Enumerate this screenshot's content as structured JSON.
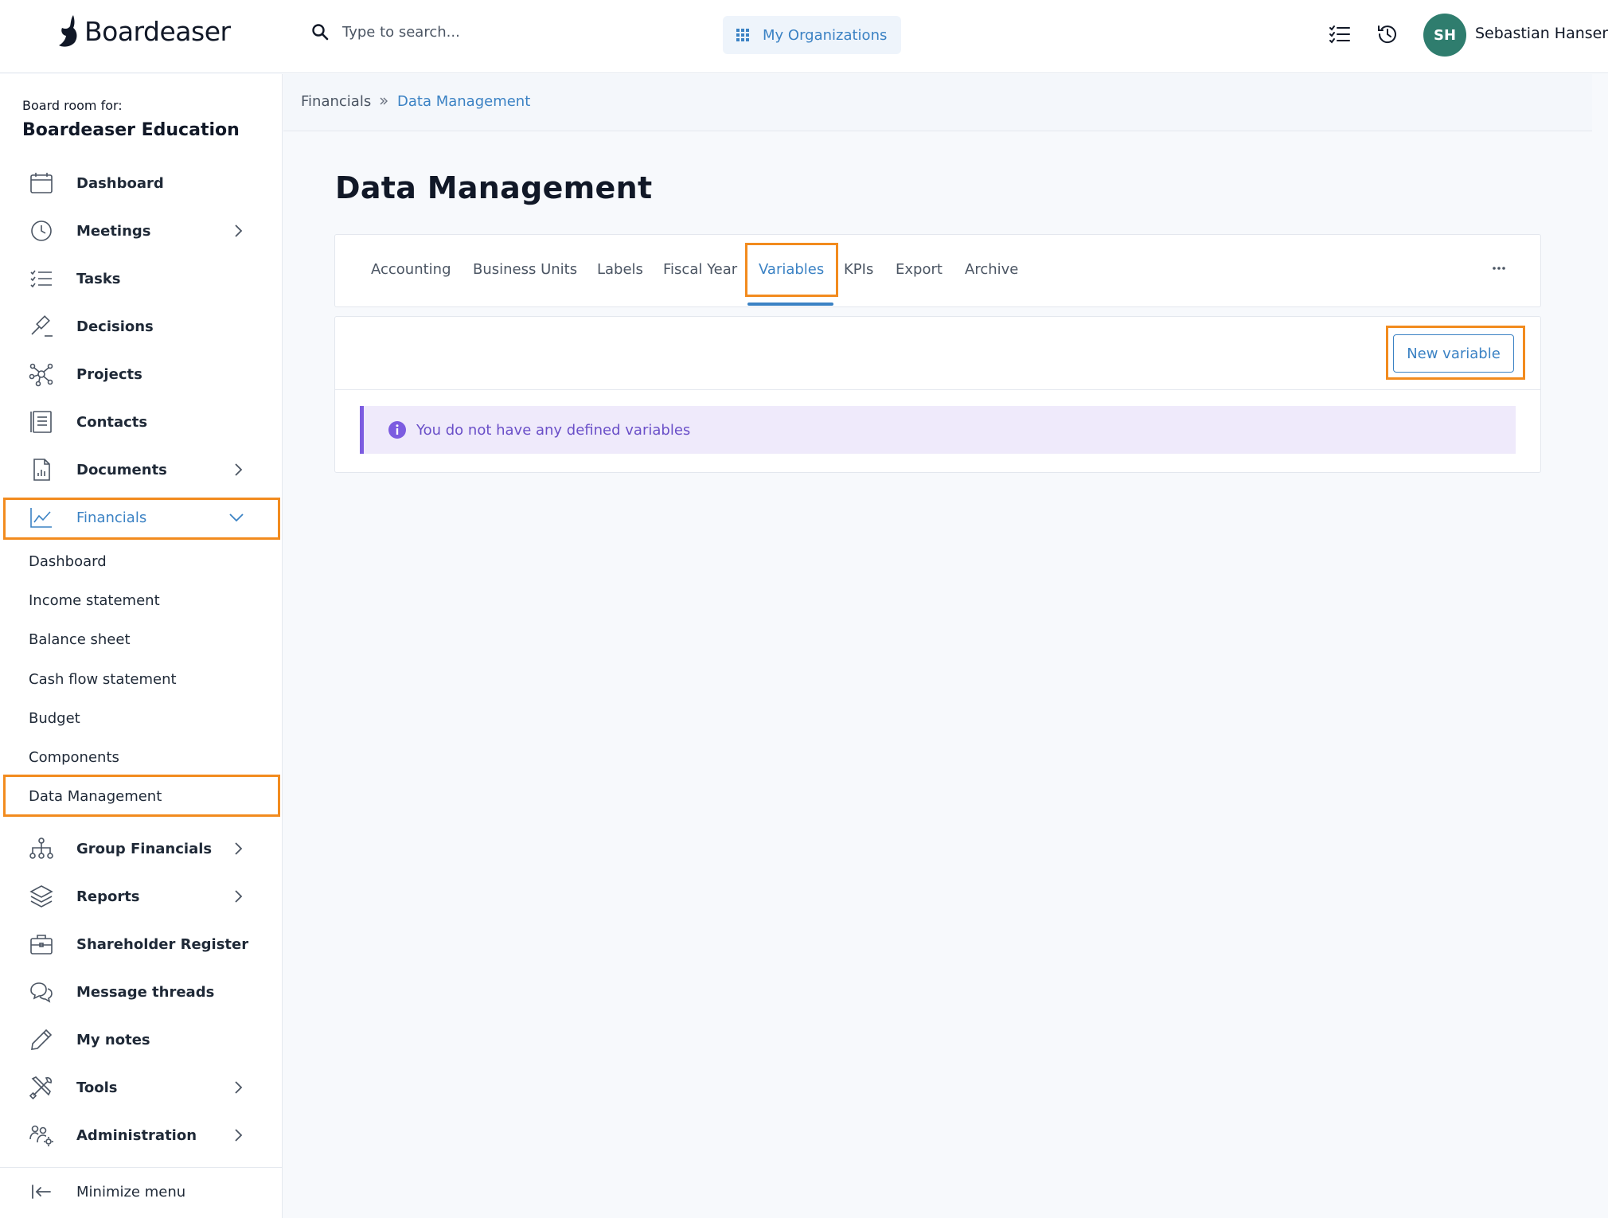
{
  "brand": {
    "name": "Boardeaser"
  },
  "search": {
    "placeholder": "Type to search..."
  },
  "header": {
    "orgs_label": "My Organizations",
    "user_initials": "SH",
    "user_name": "Sebastian Hansen"
  },
  "sidebar": {
    "board_for_label": "Board room for:",
    "board_name": "Boardeaser Education",
    "items": [
      {
        "label": "Dashboard",
        "icon": "calendar-icon"
      },
      {
        "label": "Meetings",
        "icon": "clock-icon"
      },
      {
        "label": "Tasks",
        "icon": "checklist-icon"
      },
      {
        "label": "Decisions",
        "icon": "gavel-icon"
      },
      {
        "label": "Projects",
        "icon": "network-icon"
      },
      {
        "label": "Contacts",
        "icon": "address-book-icon"
      },
      {
        "label": "Documents",
        "icon": "document-icon"
      },
      {
        "label": "Financials",
        "icon": "line-chart-icon"
      }
    ],
    "financials_sub": [
      "Dashboard",
      "Income statement",
      "Balance sheet",
      "Cash flow statement",
      "Budget",
      "Components",
      "Data Management"
    ],
    "items_after": [
      {
        "label": "Group Financials",
        "icon": "hierarchy-icon"
      },
      {
        "label": "Reports",
        "icon": "layers-icon"
      },
      {
        "label": "Shareholder Register",
        "icon": "briefcase-icon"
      },
      {
        "label": "Message threads",
        "icon": "chat-icon"
      },
      {
        "label": "My notes",
        "icon": "pencil-icon"
      },
      {
        "label": "Tools",
        "icon": "tools-icon"
      },
      {
        "label": "Administration",
        "icon": "users-gear-icon"
      }
    ],
    "minimize_label": "Minimize menu"
  },
  "breadcrumb": {
    "parent": "Financials",
    "current": "Data Management"
  },
  "main": {
    "title": "Data Management",
    "tabs": [
      "Accounting",
      "Business Units",
      "Labels",
      "Fiscal Year",
      "Variables",
      "KPIs",
      "Export",
      "Archive"
    ],
    "active_tab": "Variables",
    "new_button_label": "New variable",
    "empty_message": "You do not have any defined variables"
  },
  "colors": {
    "accent": "#3b82c4",
    "highlight": "#f28b1e",
    "info": "#7c5ce0",
    "avatar": "#2f7d6e"
  }
}
